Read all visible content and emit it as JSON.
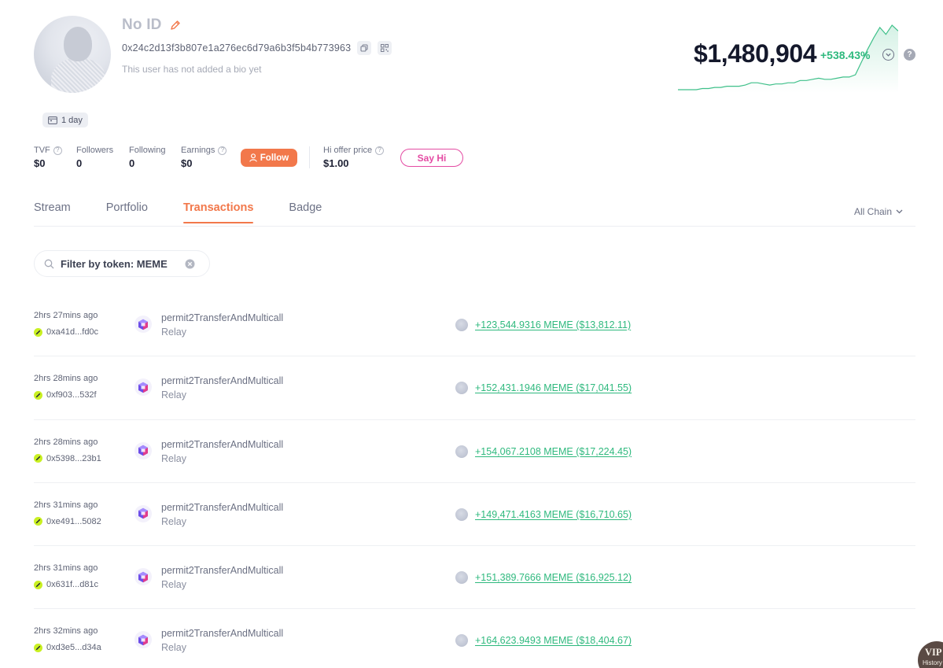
{
  "profile": {
    "name": "No ID",
    "address": "0x24c2d13f3b807e1a276ec6d79a6b3f5b4b773963",
    "bio": "This user has not added a bio yet",
    "age_badge": "1 day"
  },
  "stats": {
    "tvf": {
      "label": "TVF",
      "value": "$0"
    },
    "followers": {
      "label": "Followers",
      "value": "0"
    },
    "following": {
      "label": "Following",
      "value": "0"
    },
    "earnings": {
      "label": "Earnings",
      "value": "$0"
    },
    "follow_button": "Follow",
    "hi_offer": {
      "label": "Hi offer price",
      "value": "$1.00"
    },
    "say_hi_button": "Say Hi"
  },
  "networth": {
    "value": "$1,480,904",
    "change": "+538.43%",
    "help": "?"
  },
  "sparkline": {
    "color": "#3fc08a",
    "values": [
      1,
      1,
      1,
      1,
      1.1,
      1.1,
      1.2,
      1.2,
      1.3,
      1.3,
      1.3,
      1.4,
      1.6,
      1.6,
      1.5,
      1.4,
      1.5,
      1.5,
      1.6,
      1.6,
      1.8,
      1.8,
      1.9,
      2.0,
      1.9,
      1.9,
      2.0,
      2.1,
      2.1,
      2.3,
      3.4,
      4.5,
      5.5,
      6.4,
      5.8,
      6.6,
      6.1
    ]
  },
  "tabs": [
    {
      "label": "Stream",
      "active": false
    },
    {
      "label": "Portfolio",
      "active": false
    },
    {
      "label": "Transactions",
      "active": true
    },
    {
      "label": "Badge",
      "active": false
    }
  ],
  "chain_filter": "All Chain",
  "filter": {
    "value": "Filter by token: MEME"
  },
  "transactions": [
    {
      "time": "2hrs 27mins ago",
      "hash": "0xa41d...fd0c",
      "method": "permit2TransferAndMulticall",
      "app": "Relay",
      "amount": "+123,544.9316 MEME ($13,812.11)"
    },
    {
      "time": "2hrs 28mins ago",
      "hash": "0xf903...532f",
      "method": "permit2TransferAndMulticall",
      "app": "Relay",
      "amount": "+152,431.1946 MEME ($17,041.55)"
    },
    {
      "time": "2hrs 28mins ago",
      "hash": "0x5398...23b1",
      "method": "permit2TransferAndMulticall",
      "app": "Relay",
      "amount": "+154,067.2108 MEME ($17,224.45)"
    },
    {
      "time": "2hrs 31mins ago",
      "hash": "0xe491...5082",
      "method": "permit2TransferAndMulticall",
      "app": "Relay",
      "amount": "+149,471.4163 MEME ($16,710.65)"
    },
    {
      "time": "2hrs 31mins ago",
      "hash": "0x631f...d81c",
      "method": "permit2TransferAndMulticall",
      "app": "Relay",
      "amount": "+151,389.7666 MEME ($16,925.12)"
    },
    {
      "time": "2hrs 32mins ago",
      "hash": "0xd3e5...d34a",
      "method": "permit2TransferAndMulticall",
      "app": "Relay",
      "amount": "+164,623.9493 MEME ($18,404.67)"
    }
  ],
  "vip": {
    "title": "VIP",
    "subtitle": "History"
  },
  "colors": {
    "accent": "#f2784b",
    "positive": "#2fb97e",
    "say_hi": "#e44ba3",
    "chain_dot": "#c9f022"
  },
  "icons": {
    "edit": "pencil-icon",
    "copy": "copy-icon",
    "qr": "qr-code-icon",
    "calendar": "calendar-icon",
    "help": "question-icon",
    "follow": "user-icon",
    "chevron": "chevron-down-icon",
    "search": "search-icon",
    "clear": "clear-icon",
    "relay": "relay-cube-icon",
    "token": "token-icon",
    "chain": "chain-icon"
  }
}
